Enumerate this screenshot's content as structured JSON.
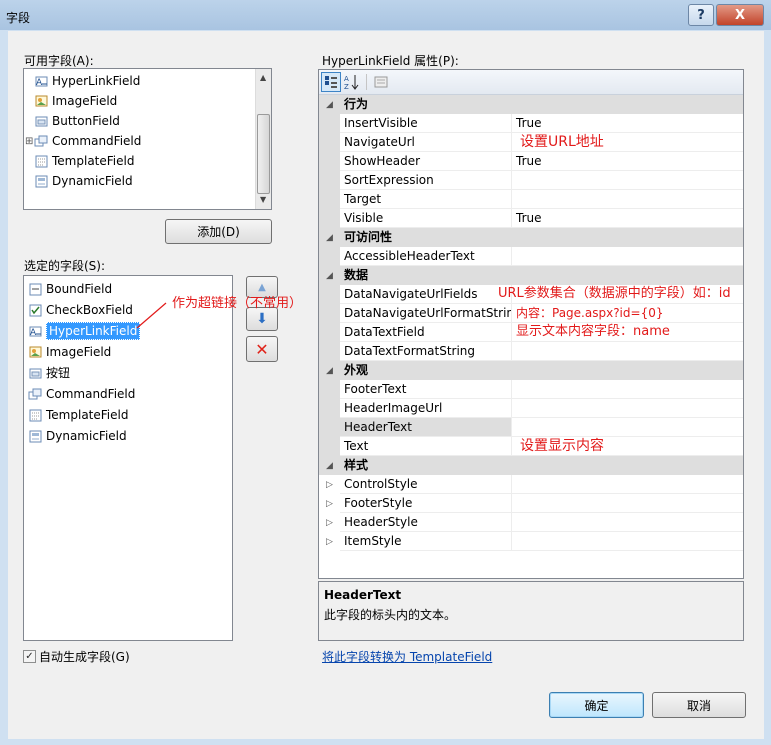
{
  "window": {
    "title": "字段"
  },
  "titlebar": {
    "help_glyph": "?",
    "close_glyph": "X"
  },
  "available": {
    "label": "可用字段(A):",
    "items": [
      {
        "label": "HyperLinkField",
        "icon": "hyperlinkfield-icon"
      },
      {
        "label": "ImageField",
        "icon": "imagefield-icon"
      },
      {
        "label": "ButtonField",
        "icon": "buttonfield-icon"
      },
      {
        "label": "CommandField",
        "icon": "commandfield-icon"
      },
      {
        "label": "TemplateField",
        "icon": "templatefield-icon"
      },
      {
        "label": "DynamicField",
        "icon": "dynamicfield-icon"
      }
    ],
    "expander": "⊞"
  },
  "add_button": "添加(D)",
  "selected": {
    "label": "选定的字段(S):",
    "items": [
      {
        "label": "BoundField",
        "icon": "boundfield-icon"
      },
      {
        "label": "CheckBoxField",
        "icon": "checkboxfield-icon"
      },
      {
        "label": "HyperLinkField",
        "icon": "hyperlinkfield-icon"
      },
      {
        "label": "ImageField",
        "icon": "imagefield-icon"
      },
      {
        "label": "按钮",
        "icon": "buttonfield-icon"
      },
      {
        "label": "CommandField",
        "icon": "commandfield-icon"
      },
      {
        "label": "TemplateField",
        "icon": "templatefield-icon"
      },
      {
        "label": "DynamicField",
        "icon": "dynamicfield-icon"
      }
    ],
    "selected_index": 2
  },
  "annotations": {
    "hyperlink_note": "作为超链接（不常用）",
    "navigate_url_note": "设置URL地址",
    "url_fields_note": "URL参数集合（数据源中的字段）如：id",
    "url_format_note": "内容：Page.aspx?id={0}",
    "text_field_note": "显示文本内容字段：name",
    "text_note": "设置显示内容"
  },
  "properties": {
    "label": "HyperLinkField 属性(P):",
    "toolbar": [
      "categorized-icon",
      "alphabetical-icon",
      "property-pages-icon"
    ],
    "categories": [
      {
        "name": "行为",
        "rows": [
          {
            "name": "InsertVisible",
            "value": "True"
          },
          {
            "name": "NavigateUrl",
            "value": ""
          },
          {
            "name": "ShowHeader",
            "value": "True"
          },
          {
            "name": "SortExpression",
            "value": ""
          },
          {
            "name": "Target",
            "value": ""
          },
          {
            "name": "Visible",
            "value": "True"
          }
        ]
      },
      {
        "name": "可访问性",
        "rows": [
          {
            "name": "AccessibleHeaderText",
            "value": ""
          }
        ]
      },
      {
        "name": "数据",
        "rows": [
          {
            "name": "DataNavigateUrlFields",
            "value": ""
          },
          {
            "name": "DataNavigateUrlFormatString",
            "value": ""
          },
          {
            "name": "DataTextField",
            "value": ""
          },
          {
            "name": "DataTextFormatString",
            "value": ""
          }
        ]
      },
      {
        "name": "外观",
        "rows": [
          {
            "name": "FooterText",
            "value": ""
          },
          {
            "name": "HeaderImageUrl",
            "value": ""
          },
          {
            "name": "HeaderText",
            "value": ""
          },
          {
            "name": "Text",
            "value": ""
          }
        ]
      },
      {
        "name": "样式",
        "rows": [
          {
            "name": "ControlStyle",
            "value": "",
            "expandable": true
          },
          {
            "name": "FooterStyle",
            "value": "",
            "expandable": true
          },
          {
            "name": "HeaderStyle",
            "value": "",
            "expandable": true
          },
          {
            "name": "ItemStyle",
            "value": "",
            "expandable": true
          }
        ]
      }
    ],
    "selected_property": "HeaderText",
    "collapse_glyph": "◢",
    "expand_glyph": "▷"
  },
  "description": {
    "title": "HeaderText",
    "text": "此字段的标头内的文本。"
  },
  "convert_link": "将此字段转换为 TemplateField",
  "auto_generate": {
    "label": "自动生成字段(G)",
    "checked": true,
    "check_glyph": "✓"
  },
  "ok_button": "确定",
  "cancel_button": "取消",
  "colors": {
    "annotation_red": "#e21a1a",
    "selection_blue": "#3399ff",
    "link_blue": "#0645ad"
  }
}
